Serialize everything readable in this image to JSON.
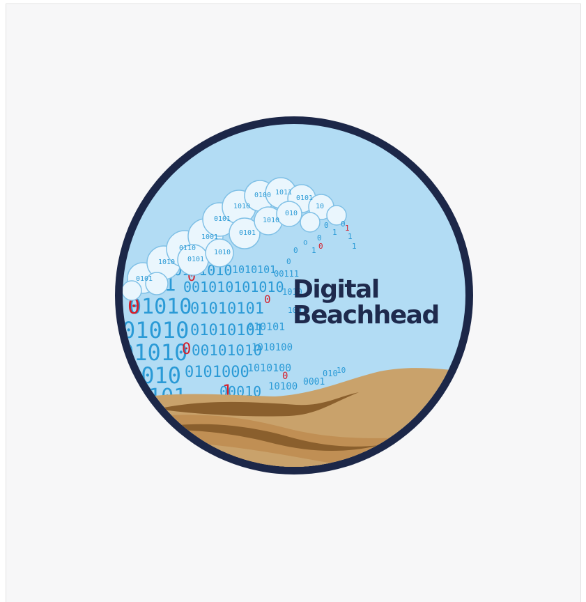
{
  "logo": {
    "title_line1": "Digital",
    "title_line2": "Beachhead",
    "colors": {
      "ring": "#1c2748",
      "sky": "#b2dcf4",
      "foam": "#e6f4fc",
      "binary_blue": "#2a9ad6",
      "binary_red": "#d51f2b",
      "sand_light": "#c9a26b",
      "sand_dark": "#8a5f2d",
      "text": "#1e2a4d"
    },
    "icon_name": "wave-of-binary-digits-icon"
  }
}
